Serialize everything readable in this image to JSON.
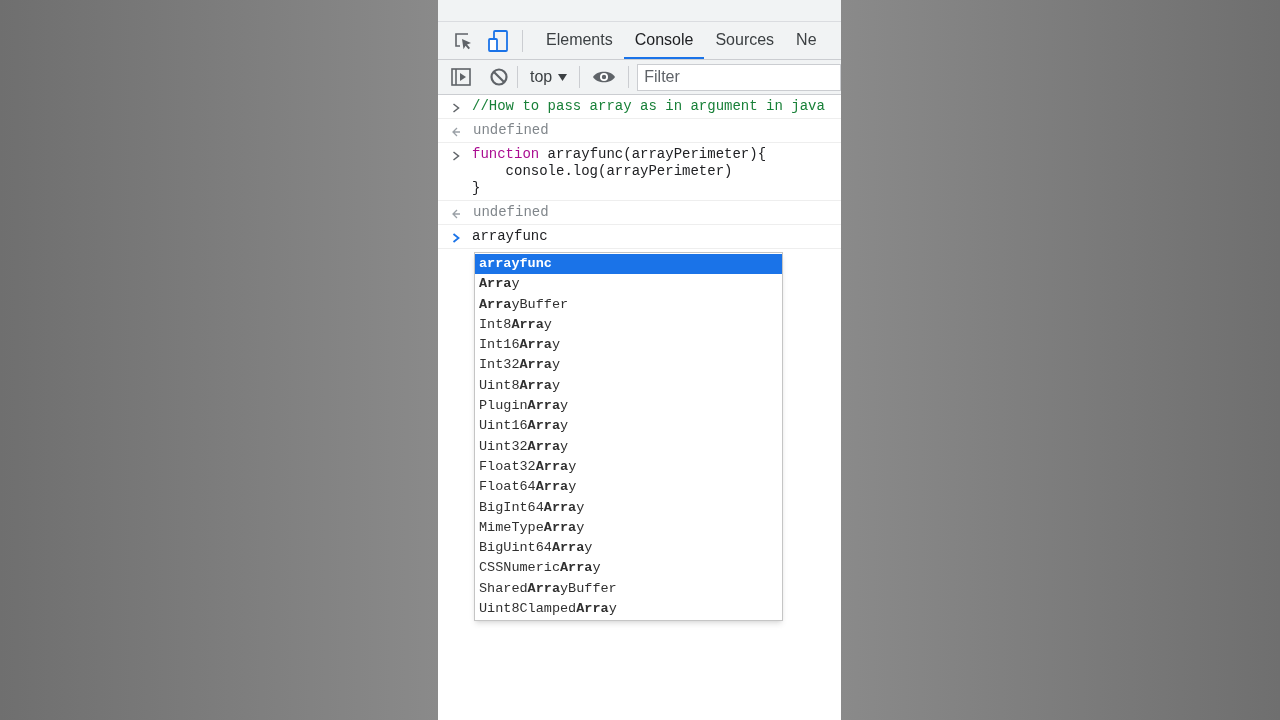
{
  "tabs": [
    {
      "label": "Elements",
      "selected": false
    },
    {
      "label": "Console",
      "selected": true
    },
    {
      "label": "Sources",
      "selected": false
    },
    {
      "label": "Ne",
      "selected": false
    }
  ],
  "toolbar": {
    "context": "top",
    "filter": {
      "placeholder": "Filter"
    }
  },
  "console": [
    {
      "kind": "comment",
      "lines": [
        "//How to pass array as in argument in java"
      ]
    },
    {
      "kind": "output",
      "lines": [
        "undefined"
      ]
    },
    {
      "kind": "code",
      "lines": [
        "**function** arrayfunc(arrayPerimeter){",
        "    console.log(arrayPerimeter)",
        "}"
      ]
    },
    {
      "kind": "output",
      "lines": [
        "undefined"
      ]
    },
    {
      "kind": "prompt",
      "lines": [
        "arrayfunc"
      ]
    }
  ],
  "suggestions": [
    {
      "label": "**arrayfunc**",
      "selected": true
    },
    {
      "label": "**Arra**y",
      "selected": false
    },
    {
      "label": "**Arra**yBuffer",
      "selected": false
    },
    {
      "label": "Int8**Arra**y",
      "selected": false
    },
    {
      "label": "Int16**Arra**y",
      "selected": false
    },
    {
      "label": "Int32**Arra**y",
      "selected": false
    },
    {
      "label": "Uint8**Arra**y",
      "selected": false
    },
    {
      "label": "Plugin**Arra**y",
      "selected": false
    },
    {
      "label": "Uint16**Arra**y",
      "selected": false
    },
    {
      "label": "Uint32**Arra**y",
      "selected": false
    },
    {
      "label": "Float32**Arra**y",
      "selected": false
    },
    {
      "label": "Float64**Arra**y",
      "selected": false
    },
    {
      "label": "BigInt64**Arra**y",
      "selected": false
    },
    {
      "label": "MimeType**Arra**y",
      "selected": false
    },
    {
      "label": "BigUint64**Arra**y",
      "selected": false
    },
    {
      "label": "CSSNumeric**Arra**y",
      "selected": false
    },
    {
      "label": "Shared**Arra**yBuffer",
      "selected": false
    },
    {
      "label": "Uint8Clamped**Arra**y",
      "selected": false
    }
  ]
}
